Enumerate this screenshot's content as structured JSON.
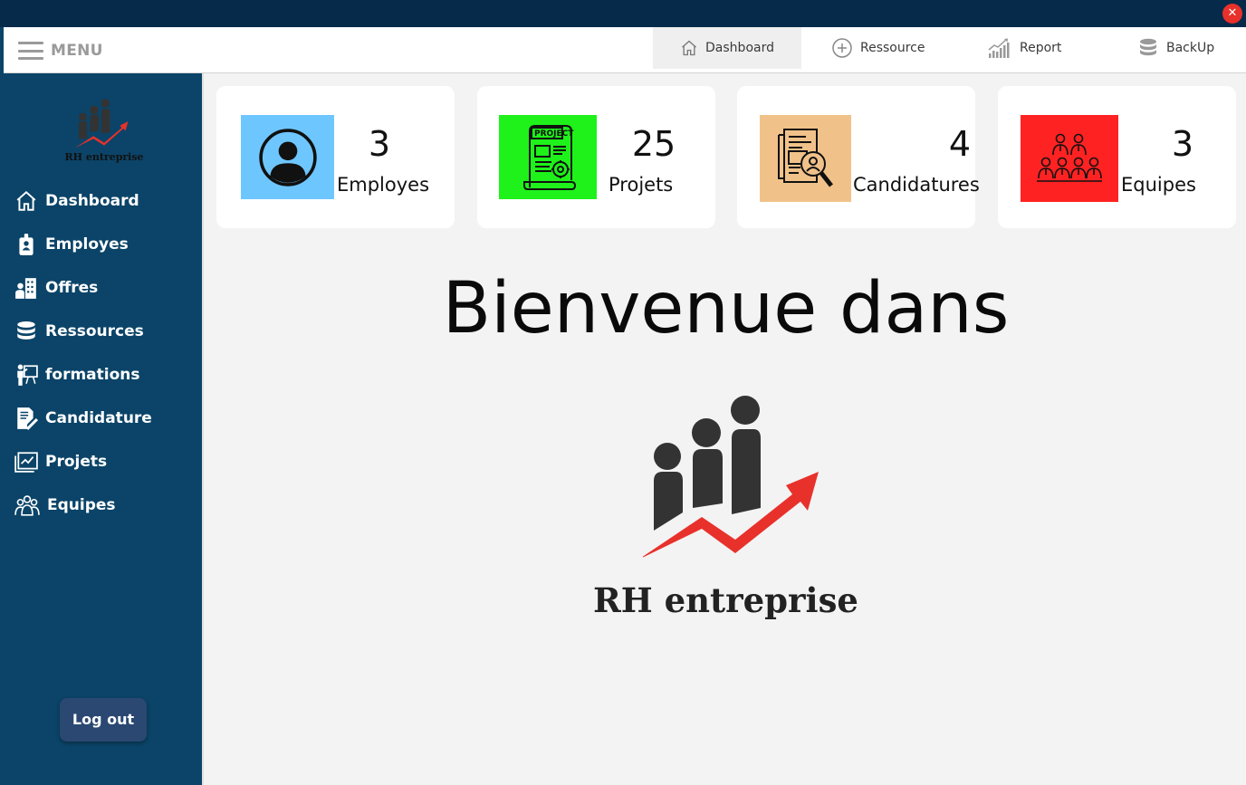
{
  "window": {
    "close_glyph": "✕"
  },
  "topbar": {
    "menu_label": "MENU",
    "nav": [
      {
        "label": "Dashboard",
        "icon": "home-icon",
        "active": true
      },
      {
        "label": "Ressource",
        "icon": "plus-circle-icon"
      },
      {
        "label": "Report",
        "icon": "report-chart-icon"
      },
      {
        "label": "BackUp",
        "icon": "database-icon"
      }
    ]
  },
  "sidebar": {
    "brand": "RH entreprise",
    "items": [
      {
        "label": "Dashboard",
        "icon": "home-icon"
      },
      {
        "label": "Employes",
        "icon": "id-badge-icon"
      },
      {
        "label": "Offres",
        "icon": "office-building-icon"
      },
      {
        "label": "Ressources",
        "icon": "database-icon"
      },
      {
        "label": "formations",
        "icon": "training-icon"
      },
      {
        "label": "Candidature",
        "icon": "document-pen-icon"
      },
      {
        "label": "Projets",
        "icon": "project-chart-icon"
      },
      {
        "label": "Equipes",
        "icon": "team-icon"
      }
    ],
    "logout_label": "Log out"
  },
  "cards": [
    {
      "value": "3",
      "label": "Employes",
      "icon": "user-circle-icon",
      "color": "#6ec6ff"
    },
    {
      "value": "25",
      "label": "Projets",
      "icon": "project-document-icon",
      "color": "#1ef21a"
    },
    {
      "value": "4",
      "label": "Candidatures",
      "icon": "candidate-search-icon",
      "color": "#f0c28a"
    },
    {
      "value": "3",
      "label": "Equipes",
      "icon": "team-group-icon",
      "color": "#ff2222"
    }
  ],
  "main": {
    "welcome_title": "Bienvenue dans",
    "brand_name": "RH entreprise"
  },
  "colors": {
    "titlebar": "#062a4a",
    "sidebar": "#0b4468",
    "logout_button": "#2a4872",
    "main_bg": "#f3f3f3",
    "logo_arrow": "#e8312b",
    "close_button": "#e8312b"
  }
}
